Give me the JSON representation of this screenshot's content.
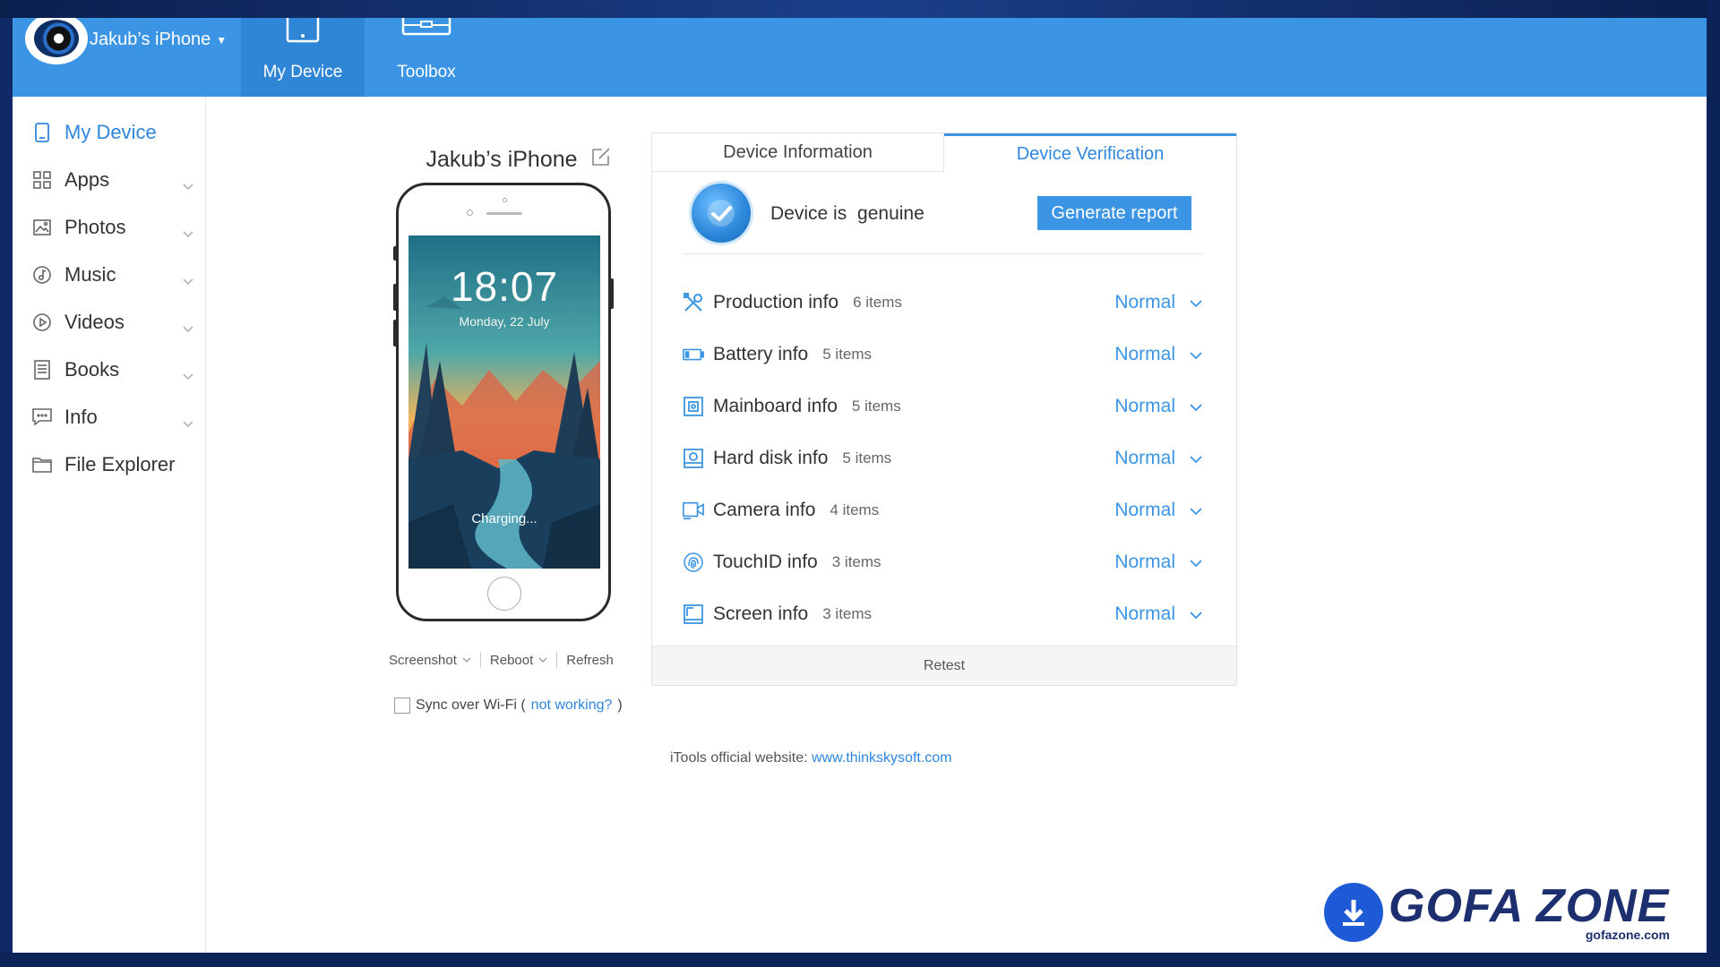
{
  "header": {
    "device_selector": "Jakub’s iPhone",
    "tabs": [
      {
        "label": "My Device"
      },
      {
        "label": "Toolbox"
      }
    ]
  },
  "sidebar": {
    "items": [
      {
        "label": "My Device",
        "icon": "phone-icon"
      },
      {
        "label": "Apps",
        "icon": "grid-icon"
      },
      {
        "label": "Photos",
        "icon": "image-icon"
      },
      {
        "label": "Music",
        "icon": "music-icon"
      },
      {
        "label": "Videos",
        "icon": "play-icon"
      },
      {
        "label": "Books",
        "icon": "book-icon"
      },
      {
        "label": "Info",
        "icon": "message-icon"
      },
      {
        "label": "File Explorer",
        "icon": "folder-icon"
      }
    ]
  },
  "device": {
    "name": "Jakub’s iPhone",
    "time": "18:07",
    "date": "Monday, 22 July",
    "charging": "Charging...",
    "actions": {
      "screenshot": "Screenshot",
      "reboot": "Reboot",
      "refresh": "Refresh"
    },
    "sync": {
      "label": "Sync over Wi-Fi (",
      "link": "not working?",
      "suffix": ")"
    }
  },
  "panel": {
    "tabs": {
      "device_information": "Device Information",
      "device_verification": "Device Verification"
    },
    "genuine": {
      "label": "Device is",
      "status": "genuine"
    },
    "generate_report": "Generate report",
    "rows": [
      {
        "label": "Production info",
        "count": "6 items",
        "status": "Normal",
        "icon": "tools-icon"
      },
      {
        "label": "Battery info",
        "count": "5 items",
        "status": "Normal",
        "icon": "battery-icon"
      },
      {
        "label": "Mainboard info",
        "count": "5 items",
        "status": "Normal",
        "icon": "chip-icon"
      },
      {
        "label": "Hard disk info",
        "count": "5 items",
        "status": "Normal",
        "icon": "disk-icon"
      },
      {
        "label": "Camera info",
        "count": "4 items",
        "status": "Normal",
        "icon": "camera-icon"
      },
      {
        "label": "TouchID info",
        "count": "3 items",
        "status": "Normal",
        "icon": "fingerprint-icon"
      },
      {
        "label": "Screen info",
        "count": "3 items",
        "status": "Normal",
        "icon": "screen-icon"
      }
    ],
    "retest": "Retest"
  },
  "footer": {
    "label": "iTools official website:",
    "link": "www.thinkskysoft.com"
  },
  "watermark": {
    "brand": "GOFA ZONE",
    "site": "gofazone.com"
  },
  "colors": {
    "accent": "#3b95e4",
    "link": "#2f86de",
    "header": "#3b95e4"
  }
}
